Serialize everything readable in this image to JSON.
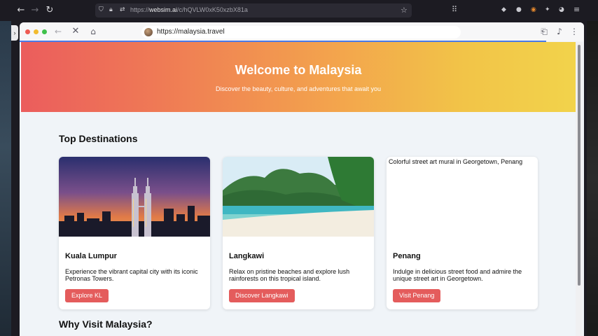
{
  "host_browser": {
    "url_prefix": "https://",
    "url_domain": "websim.ai",
    "url_path": "/c/hQVLW0xK50xzbX81a"
  },
  "inner_browser": {
    "url": "https://malaysia.travel"
  },
  "hero": {
    "title": "Welcome to Malaysia",
    "subtitle": "Discover the beauty, culture, and adventures that await you"
  },
  "sections": {
    "top_destinations": "Top Destinations",
    "why_visit": "Why Visit Malaysia?"
  },
  "destinations": [
    {
      "name": "Kuala Lumpur",
      "description": "Experience the vibrant capital city with its iconic Petronas Towers.",
      "button": "Explore KL"
    },
    {
      "name": "Langkawi",
      "description": "Relax on pristine beaches and explore lush rainforests on this tropical island.",
      "button": "Discover Langkawi"
    },
    {
      "name": "Penang",
      "image_alt": "Colorful street art mural in Georgetown, Penang",
      "description": "Indulge in delicious street food and admire the unique street art in Georgetown.",
      "button": "Visit Penang"
    }
  ],
  "colors": {
    "accent_button": "#e45c5c",
    "hero_start": "#eb5d5d",
    "hero_end": "#f2d34b",
    "page_background": "#f0f4f8"
  }
}
